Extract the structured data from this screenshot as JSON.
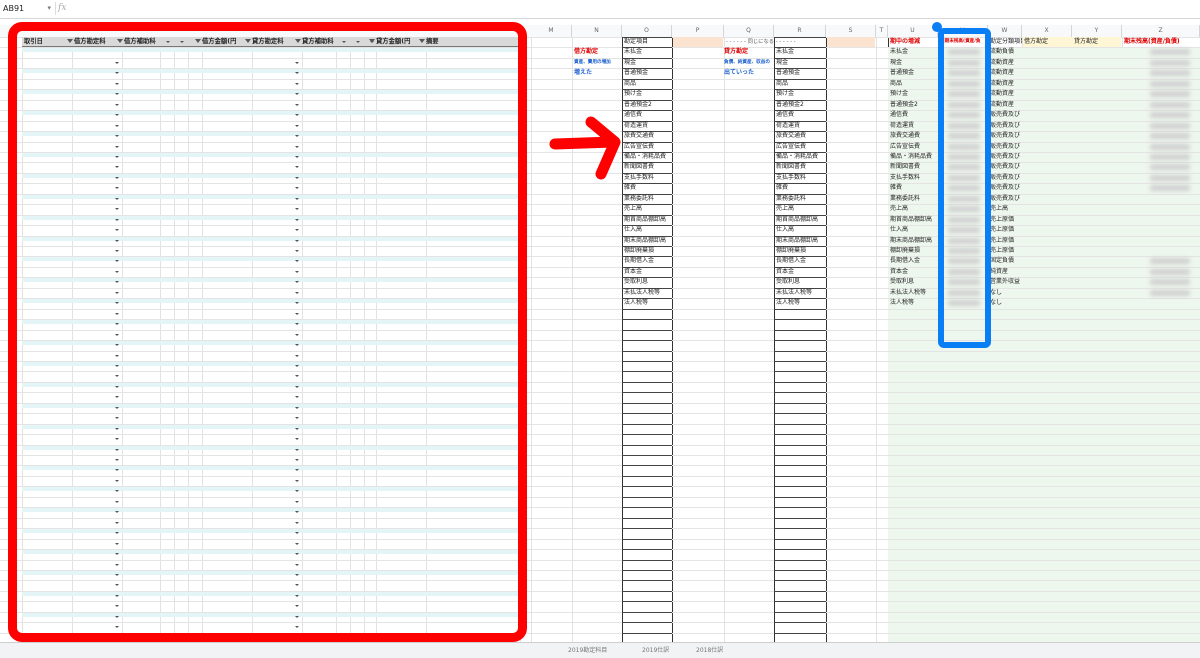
{
  "toolbar": {
    "name_box": "AB91",
    "fx": "fx"
  },
  "columns": [
    "M",
    "N",
    "O",
    "P",
    "Q",
    "R",
    "S",
    "T",
    "U",
    "V",
    "W",
    "X",
    "Y",
    "Z"
  ],
  "filter_headers": [
    {
      "label": "取引日"
    },
    {
      "label": "借方勘定科"
    },
    {
      "label": "借方補助科"
    },
    {
      "label": "借方金額(円"
    },
    {
      "label": "貸方勘定科"
    },
    {
      "label": "貸方補助科"
    },
    {
      "label": "貸方金額(円"
    },
    {
      "label": "摘要"
    }
  ],
  "side_labels": {
    "debit_title": "借方勘定",
    "debit_note": "資産、費用の増加",
    "debit_note2": "増えた",
    "credit_title": "貸方勘定",
    "credit_note": "負債、純資産、収益の",
    "credit_note2": "出ていった"
  },
  "list_o_header": "勘定項目",
  "list_q_header": "- - - - - - 同じになる - - - - - -",
  "list_o": [
    "未払金",
    "現金",
    "普通預金",
    "商品",
    "預け金",
    "普通預金2",
    "通信費",
    "荷造運賃",
    "旅費交通費",
    "広告宣伝費",
    "備品・消耗品費",
    "新聞図書費",
    "支払手数料",
    "雑費",
    "業務委託料",
    "売上高",
    "期首商品棚卸高",
    "仕入高",
    "期末商品棚卸高",
    "棚卸廃棄損",
    "長期借入金",
    "資本金",
    "受取利息",
    "未払法人税等",
    "法人税等"
  ],
  "list_r": [
    "未払金",
    "現金",
    "普通預金",
    "商品",
    "預け金",
    "普通預金2",
    "通信費",
    "荷造運賃",
    "旅費交通費",
    "広告宣伝費",
    "備品・消耗品費",
    "新聞図書費",
    "支払手数料",
    "雑費",
    "業務委託料",
    "売上高",
    "期首商品棚卸高",
    "仕入高",
    "期末商品棚卸高",
    "棚卸廃棄損",
    "長期借入金",
    "資本金",
    "受取利息",
    "未払法人税等",
    "法人税等"
  ],
  "summary_headers": {
    "u": "期中の増減",
    "v": "前期末残高(資産/負",
    "w": "勘定分類項目",
    "x": "借方勘定",
    "y": "貸方勘定",
    "z": "期末残高(資産/負債)"
  },
  "list_u": [
    "未払金",
    "現金",
    "普通預金",
    "商品",
    "預け金",
    "普通預金2",
    "通信費",
    "荷造運賃",
    "旅費交通費",
    "広告宣伝費",
    "備品・消耗品費",
    "新聞図書費",
    "支払手数料",
    "雑費",
    "業務委託料",
    "売上高",
    "期首商品棚卸高",
    "仕入高",
    "期末商品棚卸高",
    "棚卸廃棄損",
    "長期借入金",
    "資本金",
    "受取利息",
    "未払法人税等",
    "法人税等"
  ],
  "list_w": [
    "流動負債",
    "流動資産",
    "流動資産",
    "流動資産",
    "流動資産",
    "流動資産",
    "販売費及び",
    "販売費及び",
    "販売費及び",
    "販売費及び",
    "販売費及び",
    "販売費及び",
    "販売費及び",
    "販売費及び",
    "販売費及び",
    "売上高",
    "売上原価",
    "売上原価",
    "売上原価",
    "売上原価",
    "固定負債",
    "純資産",
    "営業外収益",
    "なし",
    "なし"
  ],
  "sheet_tabs": [
    "2019勘定科目",
    "2019仕訳",
    "2018仕訳"
  ],
  "annotation_colors": {
    "red_frame": "#ff0000",
    "blue_frame": "#0a7ff5",
    "arrow": "#ff0000"
  }
}
